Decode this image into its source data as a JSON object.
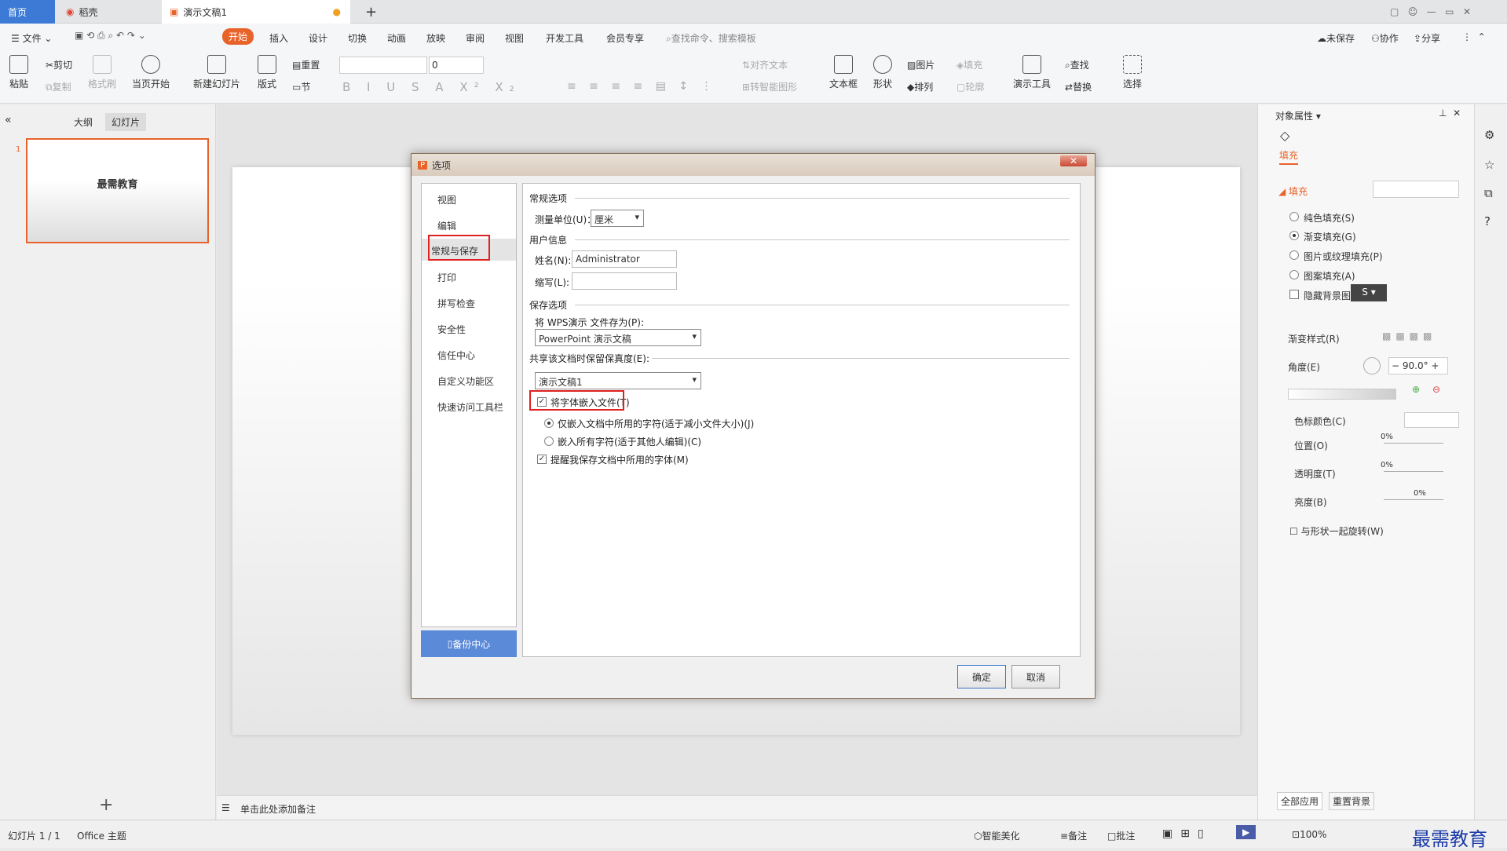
{
  "tabs": {
    "home": "首页",
    "daoke": "稻壳",
    "doc": "演示文稿1",
    "add": "+"
  },
  "menu": {
    "file": "文件",
    "items": [
      "开始",
      "插入",
      "设计",
      "切换",
      "动画",
      "放映",
      "审阅",
      "视图",
      "开发工具",
      "会员专享"
    ],
    "search": "查找命令、搜索模板",
    "unsaved": "未保存",
    "collab": "协作",
    "share": "分享"
  },
  "ribbon": {
    "paste": "粘贴",
    "cut": "剪切",
    "copy": "复制",
    "format_painter": "格式刷",
    "from_current": "当页开始",
    "new_slide": "新建幻灯片",
    "layout": "版式",
    "reset": "重置",
    "section": "节",
    "font_size": "0",
    "text_box": "文本框",
    "shape": "形状",
    "picture": "图片",
    "fill": "填充",
    "arrange": "排列",
    "outline": "轮廓",
    "present_tool": "演示工具",
    "find": "查找",
    "replace": "替换",
    "select": "选择",
    "align_text": "对齐文本",
    "smart_art": "转智能图形"
  },
  "left": {
    "outline_tab": "大纲",
    "slides_tab": "幻灯片",
    "slide_num": "1",
    "slide_title": "最需教育",
    "add": "+"
  },
  "notes": "单击此处添加备注",
  "status": {
    "slide": "幻灯片 1 / 1",
    "theme": "Office 主题",
    "beautify": "智能美化",
    "notes": "备注",
    "comment": "批注",
    "zoom": "100%"
  },
  "dialog": {
    "title": "选项",
    "nav": [
      "视图",
      "编辑",
      "常规与保存",
      "打印",
      "拼写检查",
      "安全性",
      "信任中心",
      "自定义功能区",
      "快速访问工具栏"
    ],
    "backup": "备份中心",
    "general": "常规选项",
    "unit_label": "测量单位(U)：",
    "unit_value": "厘米",
    "user_info": "用户信息",
    "name_label": "姓名(N):",
    "name_value": "Administrator",
    "initials_label": "缩写(L):",
    "save_options": "保存选项",
    "save_as_label": "将 WPS演示 文件存为(P):",
    "save_as_value": "PowerPoint 演示文稿",
    "fidelity_label": "共享该文档时保留保真度(E):",
    "fidelity_value": "演示文稿1",
    "embed_fonts": "将字体嵌入文件(T)",
    "embed_used": "仅嵌入文档中所用的字符(适于减小文件大小)(J)",
    "embed_all": "嵌入所有字符(适于其他人编辑)(C)",
    "remind": "提醒我保存文档中所用的字体(M)",
    "ok": "确定",
    "cancel": "取消"
  },
  "panel": {
    "title": "对象属性",
    "fill_tab": "填充",
    "fill_section": "填充",
    "options": [
      "纯色填充(S)",
      "渐变填充(G)",
      "图片或纹理填充(P)",
      "图案填充(A)"
    ],
    "hide_bg": "隐藏背景图形(H)",
    "gradient_style": "渐变样式(R)",
    "angle": "角度(E)",
    "angle_value": "90.0°",
    "stop_color": "色标颜色(C)",
    "position": "位置(O)",
    "transparency": "透明度(T)",
    "brightness": "亮度(B)",
    "pct": "0%",
    "rotate": "与形状一起旋转(W)",
    "apply_all": "全部应用",
    "reset_bg": "重置背景"
  },
  "watermark": "最需教育"
}
